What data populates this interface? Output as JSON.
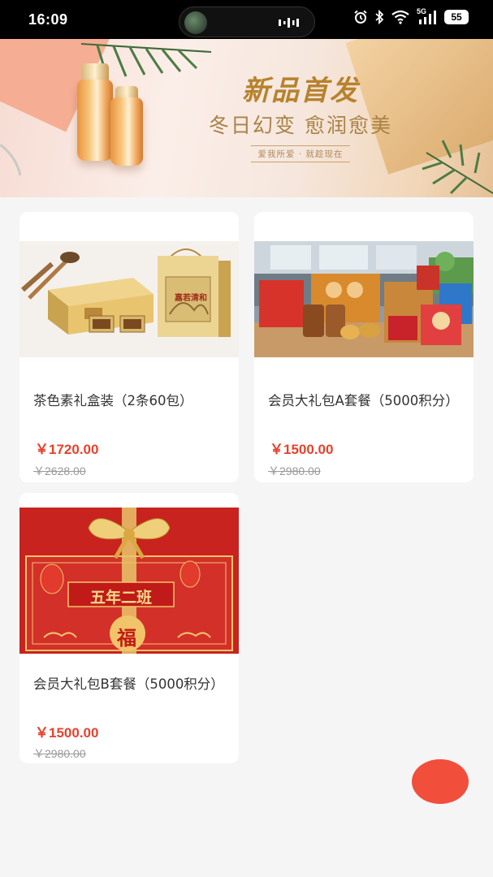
{
  "status": {
    "time": "16:09",
    "network": "5G",
    "battery": "55",
    "icons": [
      "alarm-icon",
      "bluetooth-icon",
      "wifi-icon",
      "cellular-signal-icon",
      "battery-icon"
    ]
  },
  "banner": {
    "headline": "新品首发",
    "subline": "冬日幻变 愈润愈美",
    "tagline": "爱我所爱 · 就趁现在"
  },
  "products": [
    {
      "title": "茶色素礼盒装（2条60包）",
      "price": "￥1720.00",
      "original_price": "￥2628.00"
    },
    {
      "title": "会员大礼包A套餐（5000积分）",
      "price": "￥1500.00",
      "original_price": "￥2980.00"
    },
    {
      "title": "会员大礼包B套餐（5000积分）",
      "price": "￥1500.00",
      "original_price": "￥2980.00"
    }
  ],
  "images": {
    "gift_box_label": "嘉若清和",
    "box_b_label": "五年二班",
    "box_b_char": "福"
  },
  "colors": {
    "price": "#e8412c",
    "fab": "#f24e3c",
    "page_bg": "#f5f5f5",
    "card_bg": "#ffffff"
  }
}
